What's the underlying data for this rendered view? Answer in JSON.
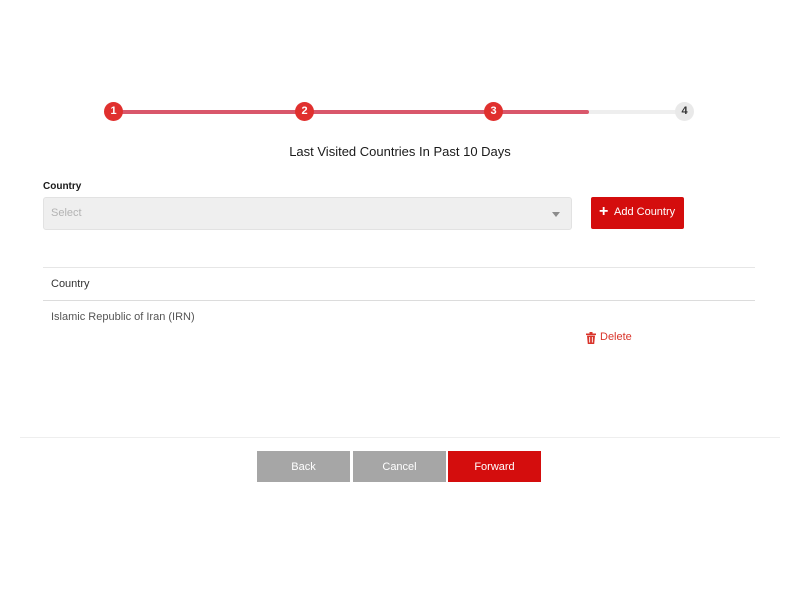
{
  "stepper": {
    "steps": [
      {
        "label": "1",
        "state": "done"
      },
      {
        "label": "2",
        "state": "done"
      },
      {
        "label": "3",
        "state": "done"
      },
      {
        "label": "4",
        "state": "todo"
      }
    ],
    "progress_fraction": 0.82,
    "active_color": "#e0302e",
    "track_fill_color": "#d9576b"
  },
  "form": {
    "title": "Last Visited Countries In Past 10 Days",
    "country_label": "Country",
    "country_select": {
      "placeholder": "Select",
      "icon": "chevron-down-icon"
    },
    "add_button": {
      "label": "Add Country",
      "icon": "plus-icon",
      "color": "#d40d0d"
    }
  },
  "table": {
    "header": "Country",
    "rows": [
      {
        "country": "Islamic Republic of Iran (IRN)",
        "delete_label": "Delete",
        "delete_icon": "trash-icon"
      }
    ]
  },
  "footer": {
    "back_label": "Back",
    "cancel_label": "Cancel",
    "forward_label": "Forward",
    "secondary_color": "#a6a6a6",
    "primary_color": "#d40d0d"
  }
}
